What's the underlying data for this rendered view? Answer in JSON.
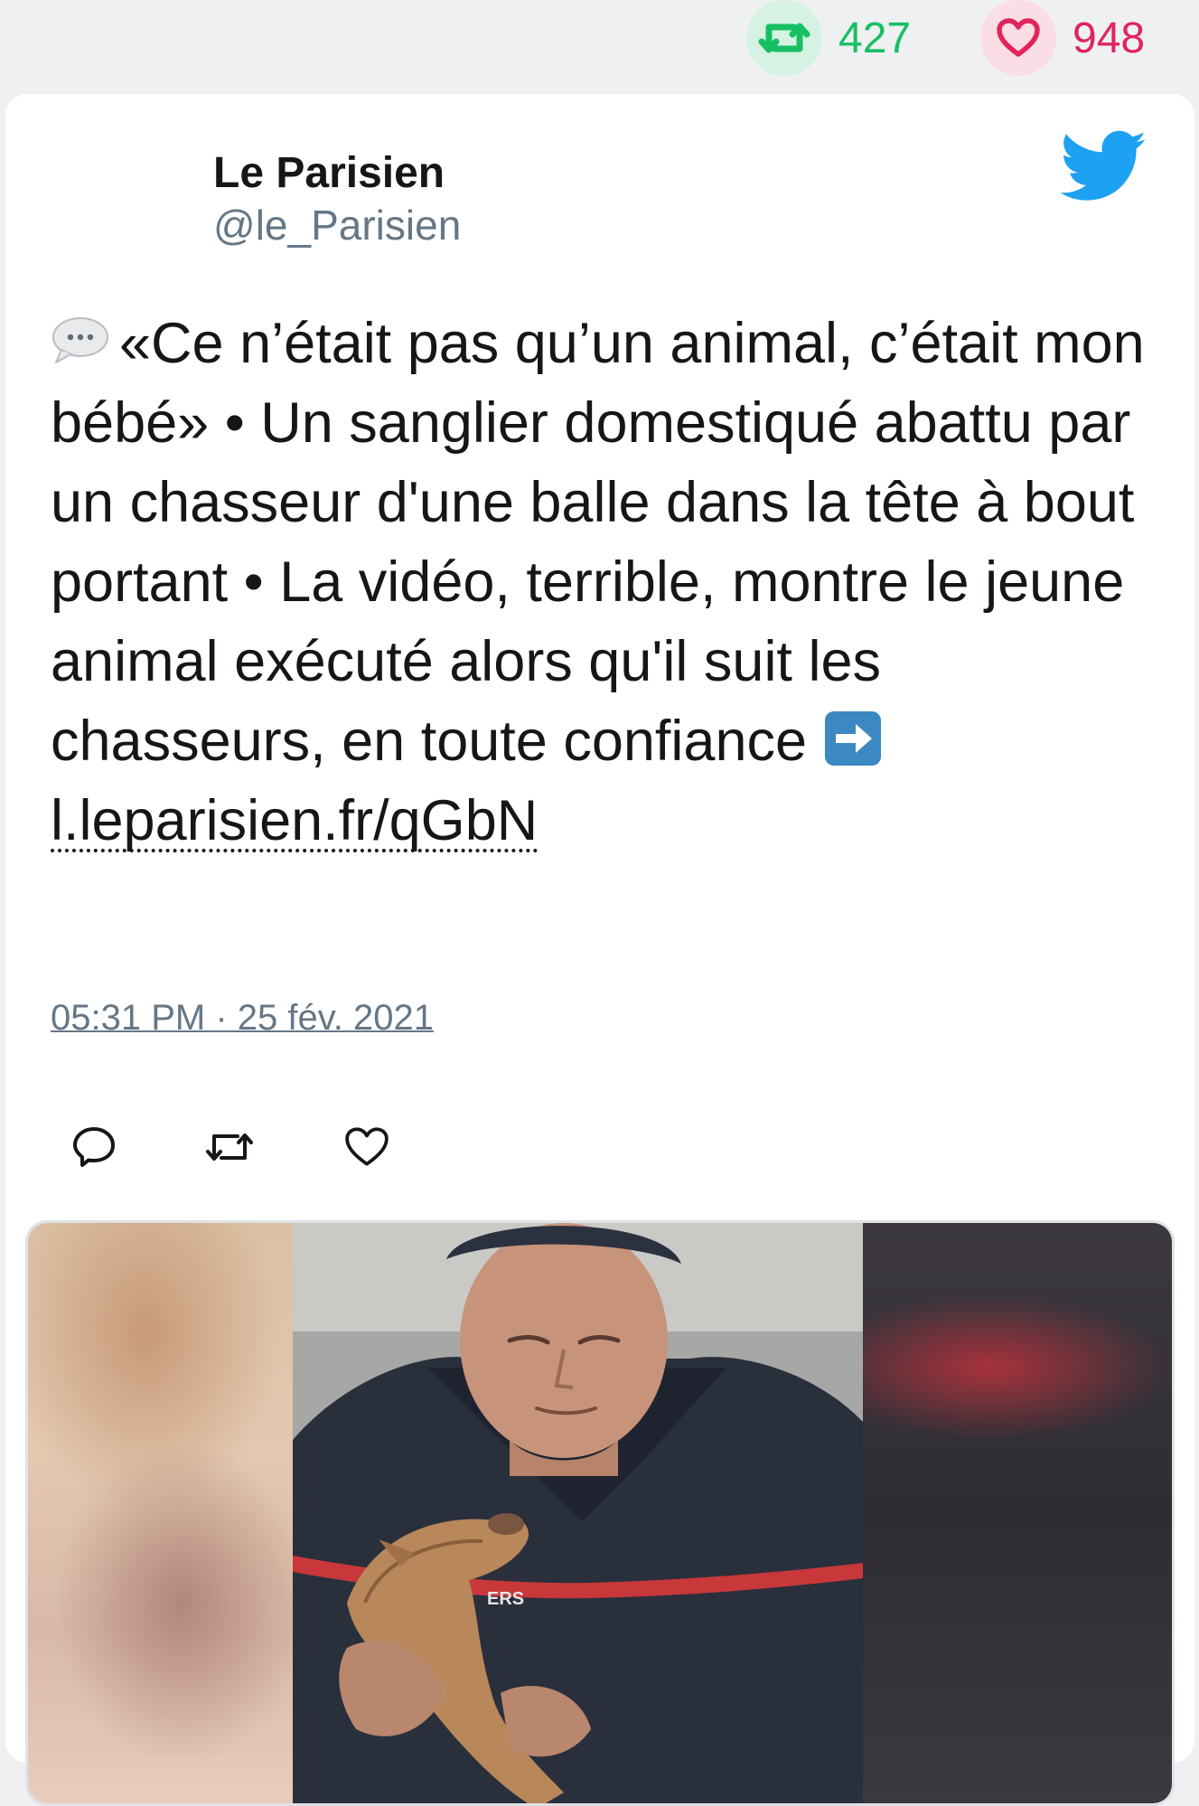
{
  "stats": {
    "retweets": "427",
    "likes": "948"
  },
  "tweet": {
    "author_name": "Le Parisien",
    "author_handle": "@le_Parisien",
    "text_main": "«Ce n’était pas qu’un animal, c’était mon bébé» • Un sanglier domestiqué abattu par un chasseur d'une balle dans la tête à bout portant • La vidéo, terrible, montre le jeune animal exécuté alors qu'il suit les chasseurs, en toute confiance",
    "link": "l.leparisien.fr/qGbN",
    "timestamp": "05:31 PM · 25 fév. 2021"
  },
  "media": {
    "jacket_text": "ERS"
  },
  "colors": {
    "retweet_green": "#17bf63",
    "like_red": "#e0245e",
    "twitter_blue": "#1da1f2",
    "secondary_text": "#657786"
  }
}
